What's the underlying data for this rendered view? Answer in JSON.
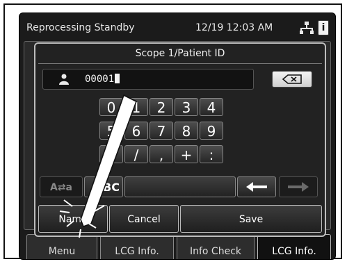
{
  "status": {
    "title": "Reprocessing Standby",
    "datetime": "12/19 12:03 AM",
    "info_symbol": "i"
  },
  "dialog": {
    "title": "Scope 1/Patient ID",
    "field_value": "00001"
  },
  "keypad": {
    "row1": [
      "0",
      "1",
      "2",
      "3",
      "4"
    ],
    "row2": [
      "5",
      "6",
      "7",
      "8",
      "9"
    ],
    "row3": [
      "-",
      "/",
      ",",
      "+",
      ":"
    ],
    "mode_label": "A⇄a",
    "abc_label": "ABC"
  },
  "actions": {
    "name_label": "Name",
    "cancel_label": "Cancel",
    "save_label": "Save"
  },
  "background_tabs": [
    "Menu",
    "LCG Info.",
    "Info Check",
    "LCG Info."
  ],
  "icons": {
    "person": "person-icon",
    "backspace": "backspace-icon",
    "left_arrow": "left-arrow-icon",
    "right_arrow": "right-arrow-icon",
    "network": "network-icon",
    "stylus": "stylus-icon"
  }
}
